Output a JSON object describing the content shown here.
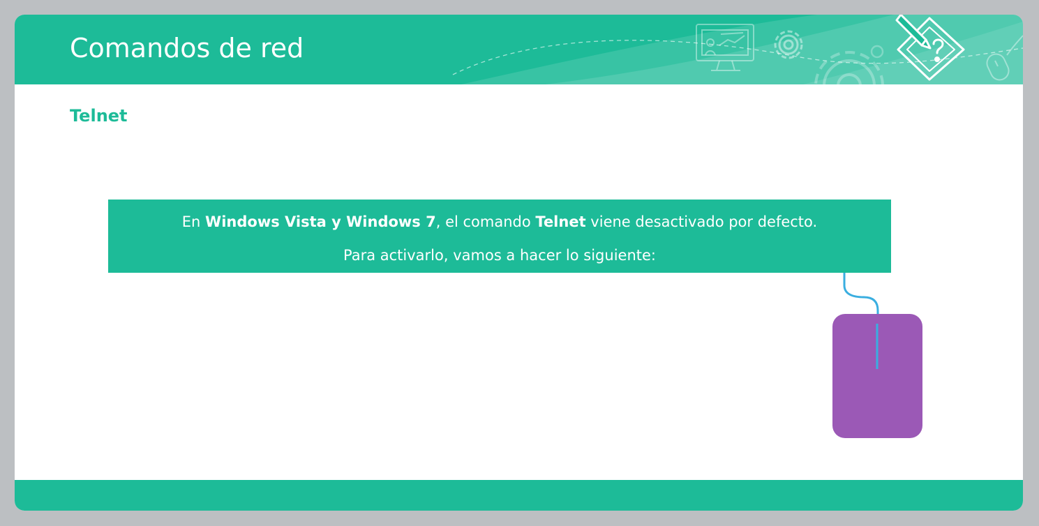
{
  "slide": {
    "title": "Comandos de red",
    "section_heading": "Telnet",
    "callout": {
      "line1": {
        "t1": "En ",
        "t2": "Windows Vista y Windows 7",
        "t3": ", el comando ",
        "t4": "Telnet",
        "t5": " viene desactivado por defecto."
      },
      "line2": "Para activarlo, vamos a hacer lo siguiente:"
    }
  },
  "icons": {
    "header_decor": [
      "presentation-screen-icon",
      "gear-icon",
      "large-gear-icon",
      "computer-mouse-icon",
      "pencil-question-icon"
    ],
    "illustration": "computer-mouse-icon"
  },
  "colors": {
    "accent": "#1dbb98",
    "mouse": "#9b59b6",
    "cable": "#3aaee0",
    "background": "#bcbfc2"
  }
}
